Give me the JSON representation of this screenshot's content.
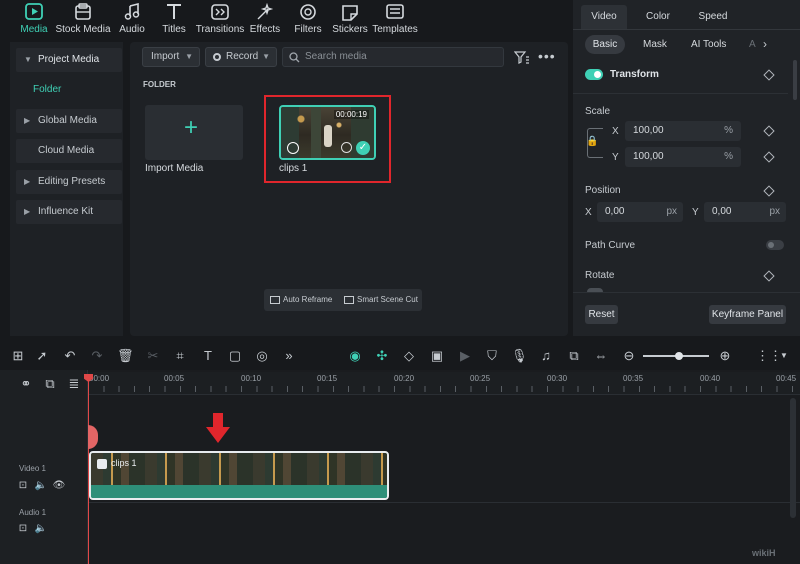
{
  "toolbar": {
    "items": [
      {
        "label": "Media",
        "icon": "media-icon",
        "active": true
      },
      {
        "label": "Stock Media",
        "icon": "stock-media-icon"
      },
      {
        "label": "Audio",
        "icon": "music-note-icon"
      },
      {
        "label": "Titles",
        "icon": "text-t-icon"
      },
      {
        "label": "Transitions",
        "icon": "transitions-icon"
      },
      {
        "label": "Effects",
        "icon": "effects-icon"
      },
      {
        "label": "Filters",
        "icon": "filters-icon"
      },
      {
        "label": "Stickers",
        "icon": "stickers-icon"
      },
      {
        "label": "Templates",
        "icon": "templates-icon"
      }
    ],
    "accent": "#3fd0b5"
  },
  "sidebar": {
    "project_media": "Project Media",
    "folder": "Folder",
    "global_media": "Global Media",
    "cloud_media": "Cloud Media",
    "editing_presets": "Editing Presets",
    "influence_kit": "Influence Kit"
  },
  "content": {
    "import_label": "Import",
    "record_label": "Record",
    "search_placeholder": "Search media",
    "folder_heading": "FOLDER",
    "import_media_label": "Import Media",
    "clip": {
      "name": "clips 1",
      "duration": "00:00:19"
    },
    "auto_reframe": "Auto Reframe",
    "smart_scene_cut": "Smart Scene Cut"
  },
  "right": {
    "tabs": [
      "Video",
      "Color",
      "Speed"
    ],
    "subtabs": [
      "Basic",
      "Mask",
      "AI Tools",
      "A"
    ],
    "transform": "Transform",
    "scale": "Scale",
    "scale_x": "100,00",
    "scale_y": "100,00",
    "percent": "%",
    "position": "Position",
    "pos_x": "0,00",
    "pos_y": "0,00",
    "px": "px",
    "x": "X",
    "y": "Y",
    "path_curve": "Path Curve",
    "rotate": "Rotate",
    "reset": "Reset",
    "keyframe_panel": "Keyframe Panel"
  },
  "timeline": {
    "ticks": [
      "00:00",
      "00:05",
      "00:10",
      "00:15",
      "00:20",
      "00:25",
      "00:30",
      "00:35",
      "00:40",
      "00:45"
    ],
    "video_track": "Video 1",
    "audio_track": "Audio 1",
    "clip_label": "clips 1"
  },
  "watermark": "wikiH"
}
